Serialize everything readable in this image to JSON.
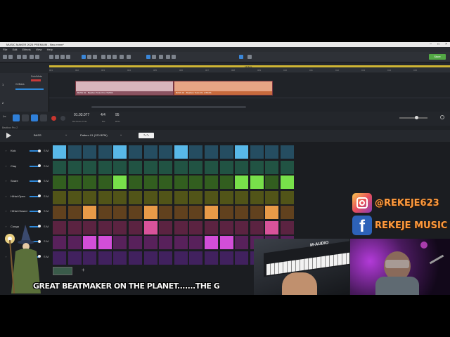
{
  "window": {
    "title": "MUSIC MAKER 2025 PREMIUM - Neu.mmm*"
  },
  "menu": [
    "File",
    "Edit",
    "Effects",
    "View",
    "Help"
  ],
  "toolbar": {
    "store_label": "Store"
  },
  "arranger": {
    "ruler_marks": [
      "001",
      "002",
      "003",
      "004",
      "005",
      "006",
      "007",
      "008",
      "009",
      "010",
      "011",
      "012",
      "013",
      "014",
      "015"
    ],
    "loop_label": "16 Bars",
    "tracks": [
      {
        "name": "Solo/Mute",
        "number": "1"
      },
      {
        "name": "Gr/Bass",
        "number": "2"
      }
    ],
    "clips": [
      {
        "label": "BASS 01 - Beatbox Tools Pro 2 BASS"
      },
      {
        "label": "BASS 01 - Beatbox Tools Pro 2 BASS"
      }
    ]
  },
  "transport": {
    "position": "01.03.077",
    "position_sub": "Bar.Beats.Ticks",
    "time_signature": "4/4",
    "time_signature_sub": "Bar",
    "bpm": "95",
    "bpm_sub": "BPM"
  },
  "beatbox": {
    "panel_name": "Beatbox Pro 2",
    "kit": "BASS",
    "pattern": "Pattern 01 (120 BPM)",
    "wave_icon": "waveform-icon",
    "rows": [
      {
        "label": "Kick",
        "color": "#58b8e8"
      },
      {
        "label": "Clap",
        "color": "#4ec5a0"
      },
      {
        "label": "Snare",
        "color": "#78e04a"
      },
      {
        "label": "HiHat Open",
        "color": "#c0c83a"
      },
      {
        "label": "HiHat Closed",
        "color": "#e89a48"
      },
      {
        "label": "Conga",
        "color": "#d8539a"
      },
      {
        "label": "",
        "color": "#d24ed8"
      },
      {
        "label": "",
        "color": "#9a4ee0"
      }
    ],
    "solo_label": "S",
    "mute_label": "M",
    "steps": [
      [
        1,
        0,
        0,
        0,
        1,
        0,
        0,
        0,
        1,
        0,
        0,
        0,
        1,
        0,
        0,
        0
      ],
      [
        0,
        0,
        0,
        0,
        0,
        0,
        0,
        0,
        0,
        0,
        0,
        0,
        0,
        0,
        0,
        0
      ],
      [
        0,
        0,
        0,
        0,
        1,
        0,
        0,
        0,
        0,
        0,
        0,
        0,
        1,
        1,
        0,
        1
      ],
      [
        0,
        0,
        0,
        0,
        0,
        0,
        0,
        0,
        0,
        0,
        0,
        0,
        0,
        0,
        0,
        0
      ],
      [
        0,
        0,
        1,
        0,
        0,
        0,
        1,
        0,
        0,
        0,
        1,
        0,
        0,
        0,
        1,
        0
      ],
      [
        0,
        0,
        0,
        0,
        0,
        0,
        1,
        0,
        0,
        0,
        0,
        0,
        0,
        0,
        1,
        0
      ],
      [
        0,
        0,
        1,
        1,
        0,
        0,
        0,
        0,
        0,
        0,
        1,
        1,
        0,
        0,
        0,
        0
      ],
      [
        0,
        0,
        0,
        0,
        0,
        0,
        0,
        0,
        0,
        0,
        0,
        0,
        0,
        0,
        0,
        0
      ]
    ]
  },
  "overlay": {
    "ticker": "GREAT BEATMAKER ON THE PLANET.......THE G",
    "instagram": "@REKEJE623",
    "facebook": "REKEJE MUSIC",
    "keyboard_brand": "M-AUDIO"
  }
}
